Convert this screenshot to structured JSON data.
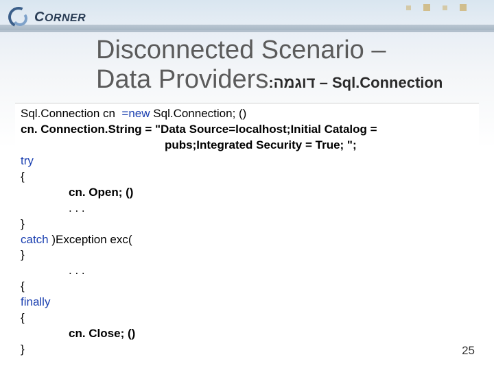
{
  "logo": {
    "text_a": "C",
    "text_b": "ORNER"
  },
  "title": {
    "line1": "Disconnected Scenario –",
    "line2": "Data Providers",
    "sub_dash": " – ",
    "sub_class": "Sql.Connection",
    "sub_heb": "דוגמה",
    "sub_colon": ":"
  },
  "code": {
    "l1a": "Sql.Connection cn ",
    "l1b": " =new",
    "l1c": " Sql.Connection; ()",
    "l2": "cn. Connection.String = \"Data Source=localhost;Initial Catalog = ",
    "l3": "pubs;Integrated Security = True; \";",
    "l4": "try",
    "l5": "{",
    "l6": "cn. Open; ()",
    "l7": ". . .",
    "l8": "}",
    "l9a": "catch",
    "l9b": " )Exception exc(",
    "l10": "}",
    "l11": ". . .",
    "l12": "{",
    "l13": "finally",
    "l14": "{",
    "l15": "cn. Close; ()",
    "l16": "}"
  },
  "page_number": "25"
}
